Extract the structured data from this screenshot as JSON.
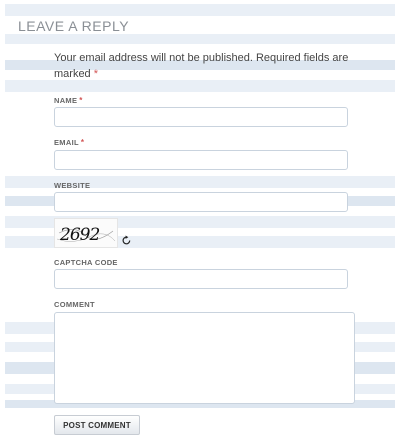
{
  "section": {
    "title": "LEAVE A REPLY",
    "notice": "Your email address will not be published. Required fields are marked",
    "required_mark": "*"
  },
  "form": {
    "name_label": "NAME",
    "email_label": "EMAIL",
    "website_label": "WEBSITE",
    "captcha_label": "CAPTCHA CODE",
    "captcha_image_text": "2692",
    "comment_label": "COMMENT",
    "submit_label": "POST COMMENT"
  },
  "icons": {
    "refresh": "refresh-icon"
  },
  "colors": {
    "required": "#d25555",
    "stripe": "#e9eff6"
  }
}
